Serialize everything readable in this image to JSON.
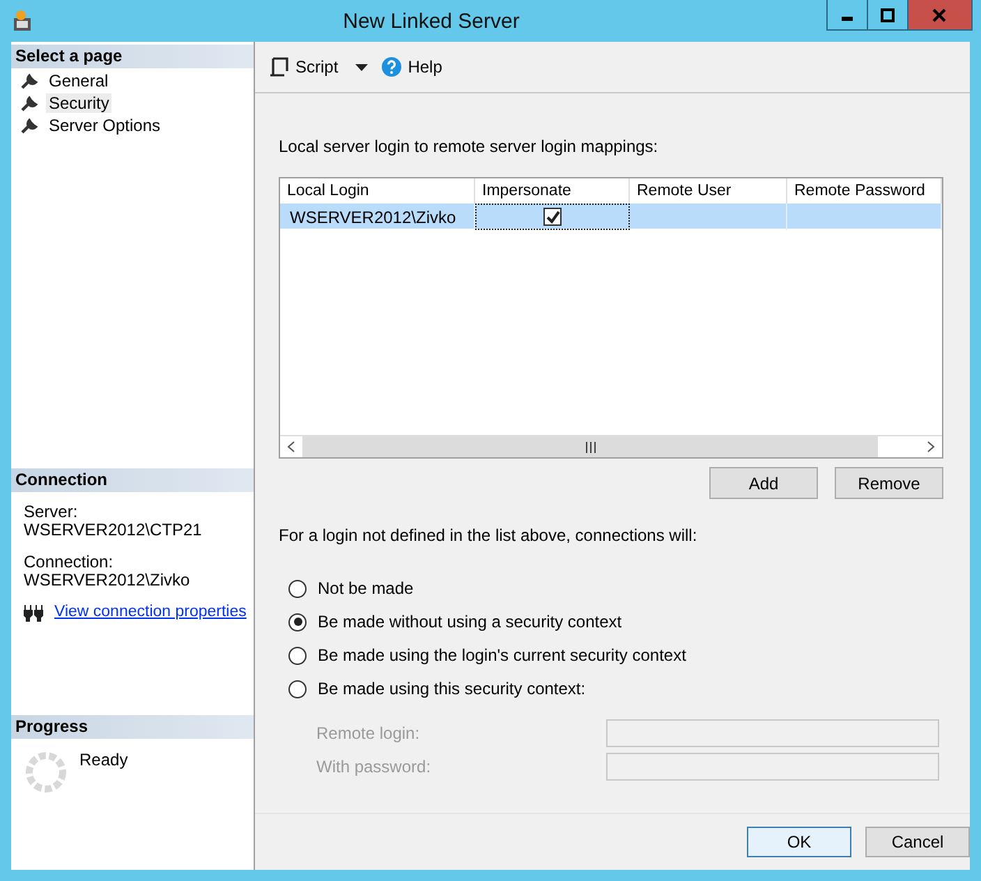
{
  "window": {
    "title": "New Linked Server"
  },
  "sidebar": {
    "header": "Select a page",
    "items": [
      {
        "label": "General",
        "selected": false
      },
      {
        "label": "Security",
        "selected": true
      },
      {
        "label": "Server Options",
        "selected": false
      }
    ]
  },
  "connection": {
    "header": "Connection",
    "server_label": "Server:",
    "server": "WSERVER2012\\CTP21",
    "connection_label": "Connection:",
    "connection": "WSERVER2012\\Zivko",
    "link": "View connection properties"
  },
  "progress": {
    "header": "Progress",
    "status": "Ready"
  },
  "toolbar": {
    "script": "Script",
    "help": "Help"
  },
  "mappings": {
    "label": "Local server login to remote server login mappings:",
    "columns": [
      "Local Login",
      "Impersonate",
      "Remote User",
      "Remote Password"
    ],
    "rows": [
      {
        "local_login": "WSERVER2012\\Zivko",
        "impersonate": true,
        "selected": true
      }
    ]
  },
  "mapping_buttons": [
    "Add",
    "Remove"
  ],
  "fallback": {
    "label": "For a login not defined in the list above, connections will:",
    "options": [
      {
        "label": "Not be made",
        "selected": false
      },
      {
        "label": "Be made without using a security context",
        "selected": true
      },
      {
        "label": "Be made using the login's current security context",
        "selected": false
      },
      {
        "label": "Be made using this security context:",
        "selected": false
      }
    ],
    "fields": [
      {
        "label": "Remote login:",
        "disabled": true
      },
      {
        "label": "With password:",
        "disabled": true
      }
    ]
  },
  "buttons": [
    "OK",
    "Cancel"
  ]
}
